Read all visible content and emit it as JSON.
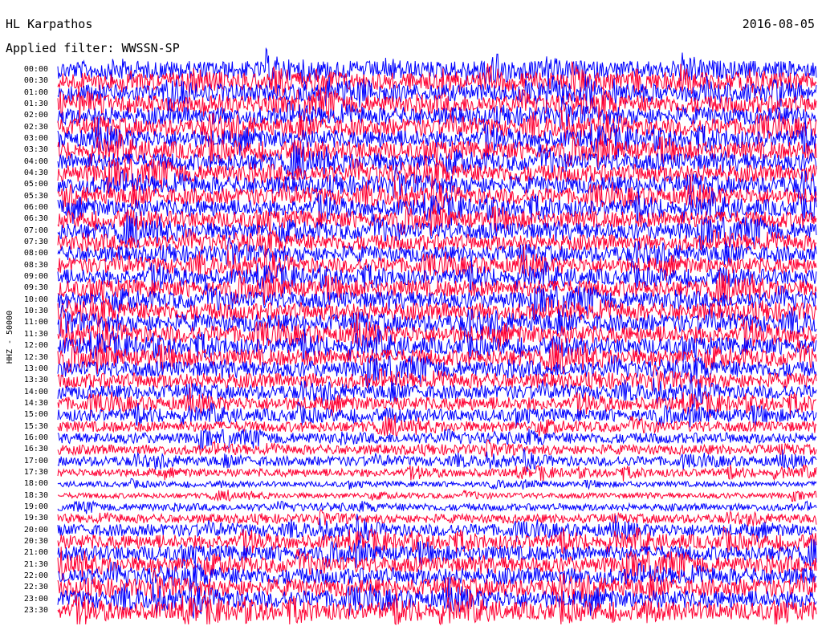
{
  "header": {
    "station": "HL Karpathos",
    "filter": "Applied filter: WWSSN-SP",
    "date": "2016-08-05",
    "channel": "HHZ - 50000"
  },
  "chart_data": {
    "type": "helicorder",
    "title": "HL Karpathos",
    "date": "2016-08-05",
    "filter": "WWSSN-SP",
    "ylabel": "HHZ - 50000",
    "rows": [
      "00:00",
      "00:30",
      "01:00",
      "01:30",
      "02:00",
      "02:30",
      "03:00",
      "03:30",
      "04:00",
      "04:30",
      "05:00",
      "05:30",
      "06:00",
      "06:30",
      "07:00",
      "07:30",
      "08:00",
      "08:30",
      "09:00",
      "09:30",
      "10:00",
      "10:30",
      "11:00",
      "11:30",
      "12:00",
      "12:30",
      "13:00",
      "13:30",
      "14:00",
      "14:30",
      "15:00",
      "15:30",
      "16:00",
      "16:30",
      "17:00",
      "17:30",
      "18:00",
      "18:30",
      "19:00",
      "19:30",
      "20:00",
      "20:30",
      "21:00",
      "21:30",
      "22:00",
      "22:30",
      "23:00",
      "23:30"
    ],
    "row_amplitude": [
      1.0,
      1.0,
      1.0,
      1.0,
      1.0,
      1.0,
      1.0,
      1.0,
      1.0,
      1.0,
      1.0,
      0.95,
      0.95,
      0.95,
      0.95,
      0.9,
      0.9,
      0.9,
      0.9,
      0.95,
      0.95,
      1.0,
      1.0,
      1.0,
      0.95,
      0.95,
      0.9,
      0.85,
      0.8,
      0.75,
      0.7,
      0.6,
      0.6,
      0.55,
      0.55,
      0.45,
      0.3,
      0.3,
      0.4,
      0.5,
      0.7,
      0.8,
      0.85,
      0.9,
      0.95,
      1.0,
      1.0,
      1.0
    ],
    "colors": [
      "#0000ff",
      "#ff0033"
    ],
    "grid": false
  }
}
